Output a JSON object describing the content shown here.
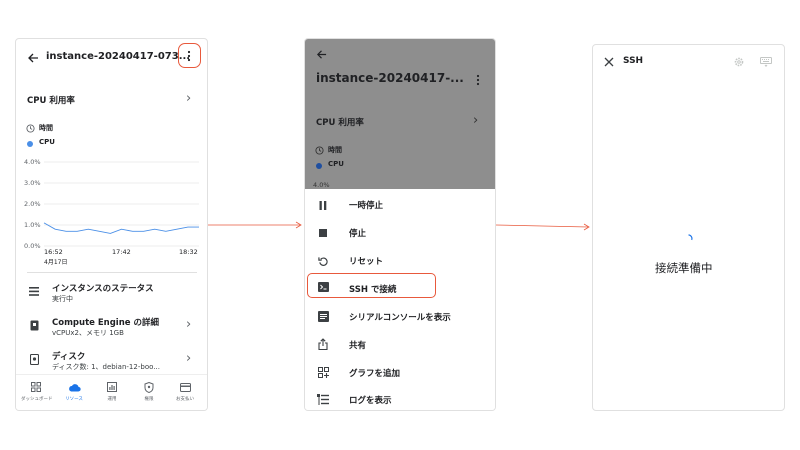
{
  "panel1": {
    "title": "instance-20240417-073...",
    "cpu_section_label": "CPU 利用率",
    "legend_time": "時間",
    "legend_cpu": "CPU",
    "y_ticks": [
      "4.0%",
      "3.0%",
      "2.0%",
      "1.0%",
      "0.0%"
    ],
    "x_ticks": [
      "16:52",
      "17:42",
      "18:32"
    ],
    "x_date": "4月17日",
    "status_title": "インスタンスのステータス",
    "status_value": "実行中",
    "compute_title": "Compute Engine の詳細",
    "compute_value": "vCPUx2、メモリ 1GB",
    "disk_title": "ディスク",
    "disk_value": "ディスク数: 1、debian-12-boo...",
    "bottom_nav": [
      "ダッシュボード",
      "リソース",
      "運用",
      "権限",
      "お支払い"
    ],
    "accent_color": "#1a73e8",
    "highlight_color": "#e8593c"
  },
  "chart_data": {
    "type": "line",
    "x": [
      "16:52",
      "17:42",
      "18:32"
    ],
    "ylim": [
      0,
      4.0
    ],
    "series": [
      {
        "values": [
          1.1,
          0.8,
          0.7,
          0.7,
          0.8,
          0.7,
          0.6,
          0.8,
          0.7,
          0.7,
          0.8,
          0.7,
          0.8,
          0.9,
          0.9
        ]
      }
    ],
    "color": "#4a8fe7"
  },
  "panel2": {
    "title": "instance-20240417-...",
    "cpu_section_label": "CPU 利用率",
    "legend_time": "時間",
    "legend_cpu": "CPU",
    "y_tick_top": "4.0%",
    "menu": [
      "一時停止",
      "停止",
      "リセット",
      "SSH で接続",
      "シリアルコンソールを表示",
      "共有",
      "グラフを追加",
      "ログを表示"
    ]
  },
  "panel3": {
    "title": "SSH",
    "status": "接続準備中"
  }
}
